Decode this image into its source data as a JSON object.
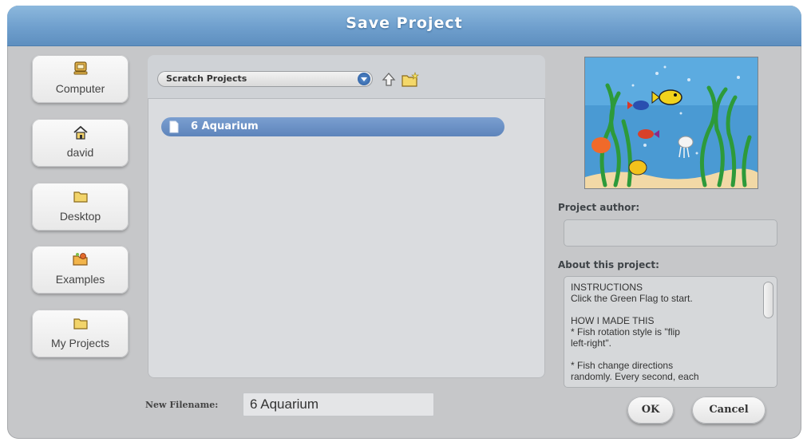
{
  "dialog": {
    "title": "Save Project"
  },
  "locations": [
    {
      "label": "Computer",
      "icon": "computer-icon"
    },
    {
      "label": "david",
      "icon": "home-icon"
    },
    {
      "label": "Desktop",
      "icon": "folder-icon"
    },
    {
      "label": "Examples",
      "icon": "examples-icon"
    },
    {
      "label": "My Projects",
      "icon": "folder-icon"
    }
  ],
  "browser": {
    "folder_select": "Scratch Projects",
    "toolbar_icons": [
      "up-folder-icon",
      "new-folder-icon"
    ],
    "items": [
      {
        "label": "6 Aquarium",
        "icon": "file-icon",
        "selected": true
      }
    ]
  },
  "filename": {
    "label": "New Filename:",
    "value": "6 Aquarium"
  },
  "side": {
    "author_label": "Project author:",
    "author_value": "",
    "about_label": "About this project:",
    "about_paragraphs": [
      [
        "INSTRUCTIONS",
        "Click the Green Flag to start."
      ],
      [
        "HOW I MADE THIS",
        "* Fish rotation style is \"flip",
        "left-right\"."
      ],
      [
        "* Fish change directions",
        "randomly. Every second, each"
      ]
    ]
  },
  "buttons": {
    "ok": "OK",
    "cancel": "Cancel"
  },
  "colors": {
    "title_bar": "#7aa8d6",
    "selected_item": "#6c92c6",
    "water": "#4a9ad3"
  }
}
